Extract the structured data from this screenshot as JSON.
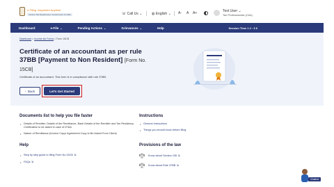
{
  "header": {
    "logo_title": "e-Filing",
    "logo_tagline": "Anywhere Anytime",
    "logo_sub": "Income Tax Department, Government of India",
    "call_us": "Call Us",
    "language": "English",
    "font_small": "A-",
    "font_normal": "A",
    "font_large": "A+",
    "user_name": "Test User",
    "user_role": "Tax Professionals (CAs)"
  },
  "nav": {
    "items": [
      "Dashboard",
      "e-File",
      "Pending Actions",
      "Grievances",
      "Help"
    ],
    "session_label": "Session Time",
    "session_time": "1 2 : 3 6"
  },
  "hero": {
    "breadcrumb": [
      "Dashboard",
      "Income tax Forms",
      "Form 15CB"
    ],
    "title": "Certificate of an accountant as per rule 37BB [Payment to Non Resident]",
    "form_no": "[Form No. 15CB]",
    "description": "Certificate of an accountant. This form is in compliance with rule 37BB.",
    "back_label": "Back",
    "start_label": "Let's Get Started"
  },
  "documents": {
    "heading": "Documents list to help you file faster",
    "items": [
      "Details of Remitter, Details of the Remittance, Bank Details of the Remitter and Tax Residency Certification to be asked in case of DTAA",
      "Nature of Remittance (Invoice Copy/ Agreement Copy to Be Asked From Client)"
    ]
  },
  "help": {
    "heading": "Help",
    "links": [
      "Step by step guide to filing Form No.15CB",
      "FAQs"
    ]
  },
  "instructions": {
    "heading": "Instructions",
    "links": [
      "General Instructions",
      "Things you should know before filing"
    ]
  },
  "provisions": {
    "heading": "Provisions of the law",
    "links": [
      "Know about Section 195",
      "Know about Rule 37BB"
    ]
  },
  "chatbot": {
    "label": "Chatbot"
  },
  "colors": {
    "primary": "#2a3a7a",
    "highlight": "#d01a1a",
    "hero_bg": "#f0f4fa"
  }
}
